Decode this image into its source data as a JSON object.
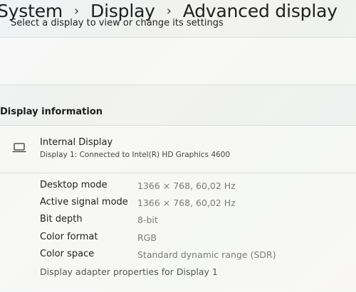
{
  "breadcrumb": {
    "items": [
      "System",
      "Display",
      "Advanced display"
    ],
    "separator": "›"
  },
  "select_display": {
    "label": "Select a display to view or change its settings"
  },
  "display_information": {
    "title": "Display information",
    "display": {
      "icon": "monitor-icon",
      "name": "Internal Display",
      "connection": "Display 1: Connected to Intel(R) HD Graphics 4600"
    },
    "details": [
      {
        "label": "Desktop mode",
        "value": "1366 × 768, 60,02 Hz"
      },
      {
        "label": "Active signal mode",
        "value": "1366 × 768, 60,02 Hz"
      },
      {
        "label": "Bit depth",
        "value": "8-bit"
      },
      {
        "label": "Color format",
        "value": "RGB"
      },
      {
        "label": "Color space",
        "value": "Standard dynamic range (SDR)"
      }
    ],
    "adapter_link": "Display adapter properties for Display 1"
  }
}
